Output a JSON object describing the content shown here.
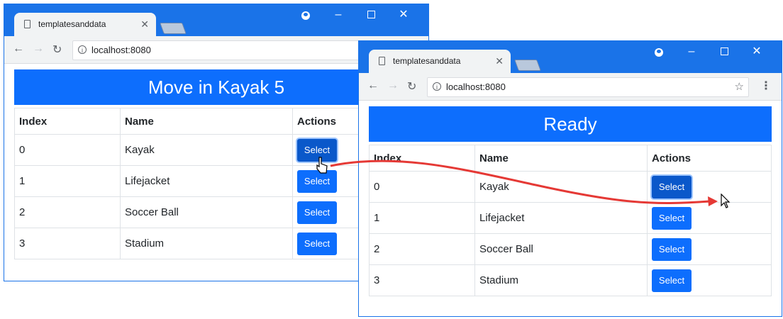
{
  "before": {
    "tab_title": "templatesanddata",
    "address": "localhost:8080",
    "banner": "Move in Kayak 5",
    "columns": [
      "Index",
      "Name",
      "Actions"
    ],
    "rows": [
      {
        "index": "0",
        "name": "Kayak",
        "action": "Select"
      },
      {
        "index": "1",
        "name": "Lifejacket",
        "action": "Select"
      },
      {
        "index": "2",
        "name": "Soccer Ball",
        "action": "Select"
      },
      {
        "index": "3",
        "name": "Stadium",
        "action": "Select"
      }
    ]
  },
  "after": {
    "tab_title": "templatesanddata",
    "address": "localhost:8080",
    "banner": "Ready",
    "columns": [
      "Index",
      "Name",
      "Actions"
    ],
    "rows": [
      {
        "index": "0",
        "name": "Kayak",
        "action": "Select"
      },
      {
        "index": "1",
        "name": "Lifejacket",
        "action": "Select"
      },
      {
        "index": "2",
        "name": "Soccer Ball",
        "action": "Select"
      },
      {
        "index": "3",
        "name": "Stadium",
        "action": "Select"
      }
    ]
  },
  "colors": {
    "chrome_blue": "#1a73e8",
    "banner_blue": "#0d6efd",
    "arrow_red": "#e53935"
  },
  "icons": [
    "page-icon",
    "close-icon",
    "account-icon",
    "minimize-icon",
    "maximize-icon",
    "back-icon",
    "forward-icon",
    "reload-icon",
    "info-icon",
    "star-icon",
    "menu-icon",
    "cursor-icon"
  ]
}
